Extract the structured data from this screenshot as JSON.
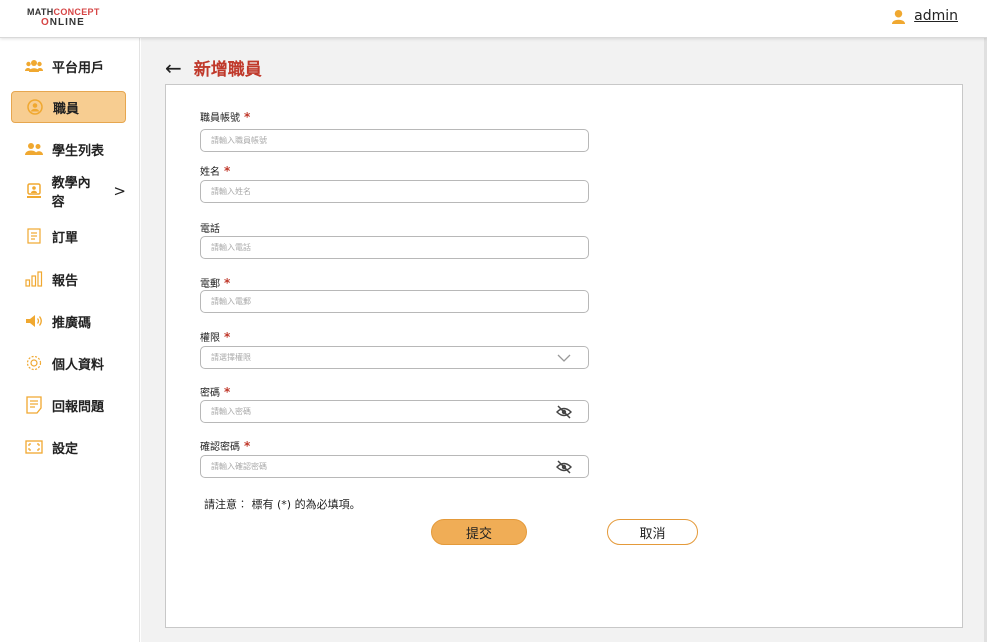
{
  "brand": {
    "line1_prefix": "MATH",
    "line1_accent": "CONCEPT",
    "line2_accent": "O",
    "line2_rest": "NLINE"
  },
  "user": {
    "name": "admin"
  },
  "sidebar": {
    "items": [
      {
        "label": "平台用戶",
        "icon": "users-icon"
      },
      {
        "label": "職員",
        "icon": "staff-icon"
      },
      {
        "label": "學生列表",
        "icon": "students-icon"
      },
      {
        "label": "教學內容",
        "icon": "teaching-icon",
        "chevron": ">"
      },
      {
        "label": "訂單",
        "icon": "orders-icon"
      },
      {
        "label": "報告",
        "icon": "report-icon"
      },
      {
        "label": "推廣碼",
        "icon": "promo-icon"
      },
      {
        "label": "個人資料",
        "icon": "profile-icon"
      },
      {
        "label": "回報問題",
        "icon": "feedback-icon"
      },
      {
        "label": "設定",
        "icon": "settings-icon"
      }
    ]
  },
  "page": {
    "back_glyph": "←",
    "title": "新增職員"
  },
  "form": {
    "required_mark": "*",
    "fields": [
      {
        "label": "職員帳號",
        "placeholder": "請輸入職員帳號",
        "required": true
      },
      {
        "label": "姓名",
        "placeholder": "請輸入姓名",
        "required": true
      },
      {
        "label": "電話",
        "placeholder": "請輸入電話",
        "required": false
      },
      {
        "label": "電郵",
        "placeholder": "請輸入電郵",
        "required": true
      },
      {
        "label": "權限",
        "placeholder": "請選擇權限",
        "required": true
      },
      {
        "label": "密碼",
        "placeholder": "請輸入密碼",
        "required": true
      },
      {
        "label": "確認密碼",
        "placeholder": "請輸入確認密碼",
        "required": true
      }
    ],
    "note": "請注意︰ 標有 (*) 的為必填項。",
    "submit_label": "提交",
    "cancel_label": "取消"
  },
  "colors": {
    "accent": "#f0ad56",
    "active_bg": "#f7cd91",
    "title_red": "#c0392b"
  }
}
